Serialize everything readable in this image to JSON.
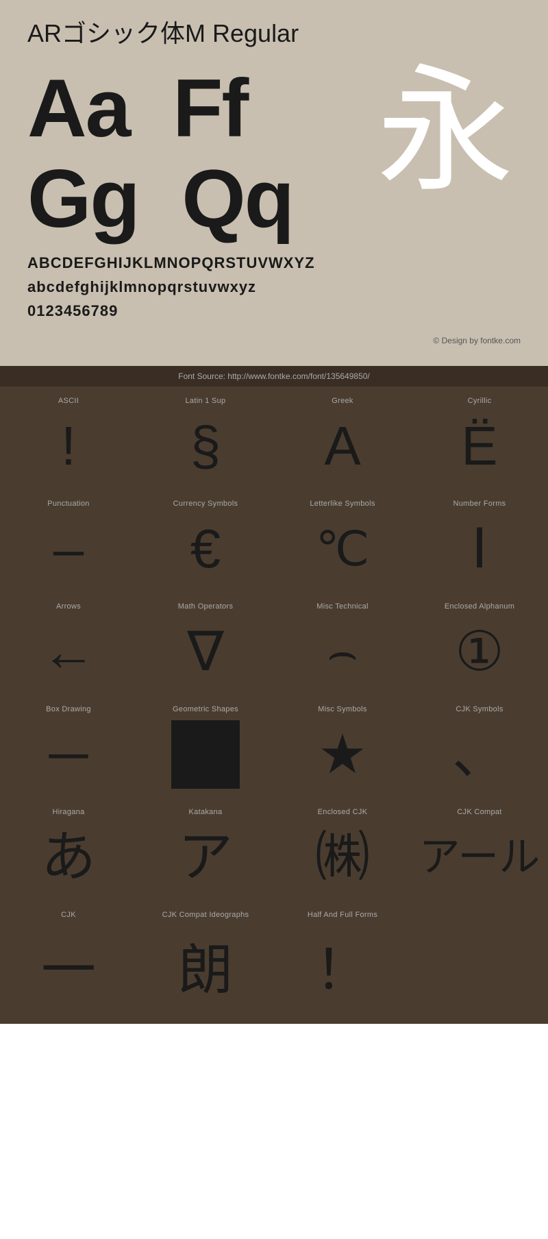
{
  "header": {
    "title": "ARゴシック体M Regular",
    "big_letters_row1": "Aa  Ff",
    "big_letters_row2": "Gg  Qq",
    "kanji": "永",
    "alphabet_upper": "ABCDEFGHIJKLMNOPQRSTUVWXYZ",
    "alphabet_lower": "abcdefghijklmnopqrstuvwxyz",
    "digits": "0123456789",
    "copyright": "© Design by fontke.com"
  },
  "font_source": {
    "label": "Font Source: http://www.fontke.com/font/135649850/"
  },
  "unicode_blocks": [
    {
      "label": "ASCII",
      "char": "!"
    },
    {
      "label": "Latin 1 Sup",
      "char": "§"
    },
    {
      "label": "Greek",
      "char": "Α"
    },
    {
      "label": "Cyrillic",
      "char": "Ё"
    },
    {
      "label": "Punctuation",
      "char": "–"
    },
    {
      "label": "Currency Symbols",
      "char": "€"
    },
    {
      "label": "Letterlike Symbols",
      "char": "℃"
    },
    {
      "label": "Number Forms",
      "char": "Ⅰ"
    },
    {
      "label": "Arrows",
      "char": "←"
    },
    {
      "label": "Math Operators",
      "char": "∇"
    },
    {
      "label": "Misc Technical",
      "char": "⌢"
    },
    {
      "label": "Enclosed Alphanum",
      "char": "①"
    },
    {
      "label": "Box Drawing",
      "char": "─"
    },
    {
      "label": "Geometric Shapes",
      "char": "■"
    },
    {
      "label": "Misc Symbols",
      "char": "★"
    },
    {
      "label": "CJK Symbols",
      "char": "、"
    }
  ],
  "bottom_blocks": [
    {
      "label": "Hiragana",
      "char": "あ"
    },
    {
      "label": "Katakana",
      "char": "ア"
    },
    {
      "label": "Enclosed CJK",
      "char": "㈱"
    },
    {
      "label": "CJK Compat",
      "char": "アール"
    }
  ],
  "last_blocks": [
    {
      "label": "CJK",
      "char": "一"
    },
    {
      "label": "CJK Compat Ideographs",
      "char": "朗"
    },
    {
      "label": "Half And Full Forms",
      "char": "！"
    },
    {
      "label": "",
      "char": ""
    }
  ]
}
